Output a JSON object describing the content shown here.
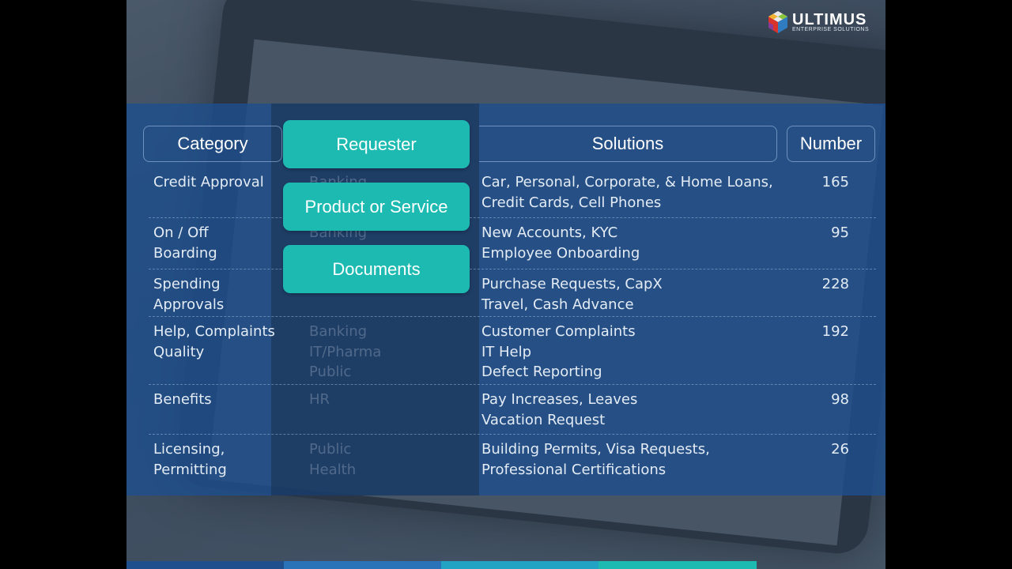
{
  "brand": {
    "name": "ULTIMUS",
    "tagline": "ENTERPRISE SOLUTIONS"
  },
  "colors": {
    "accent_teal": "#1cbab1",
    "band_blue": "#1f4f8c",
    "bar_segments": [
      "#1f4f8c",
      "#2a73b8",
      "#23a3c4",
      "#1cbab1"
    ]
  },
  "headers": {
    "category": "Category",
    "solutions": "Solutions",
    "number": "Number"
  },
  "overlay_buttons": [
    "Requester",
    "Product or Service",
    "Documents"
  ],
  "rows": [
    {
      "category": "Credit Approval",
      "industry": "Banking",
      "solutions": "Car, Personal, Corporate, & Home Loans,\nCredit Cards, Cell Phones",
      "number": "165"
    },
    {
      "category": "On / Off\nBoarding",
      "industry": "Banking",
      "solutions": "New Accounts, KYC\nEmployee Onboarding",
      "number": "95"
    },
    {
      "category": "Spending\nApprovals",
      "industry": "",
      "solutions": "Purchase Requests, CapX\nTravel, Cash Advance",
      "number": "228"
    },
    {
      "category": "Help, Complaints\nQuality",
      "industry": "Banking\nIT/Pharma\nPublic",
      "solutions": "Customer Complaints\nIT Help\nDefect Reporting",
      "number": "192"
    },
    {
      "category": "Benefits",
      "industry": "HR",
      "solutions": "Pay Increases, Leaves\nVacation Request",
      "number": "98"
    },
    {
      "category": "Licensing,\nPermitting",
      "industry": "Public\nHealth",
      "solutions": "Building Permits, Visa Requests,\nProfessional Certifications",
      "number": "26"
    }
  ]
}
